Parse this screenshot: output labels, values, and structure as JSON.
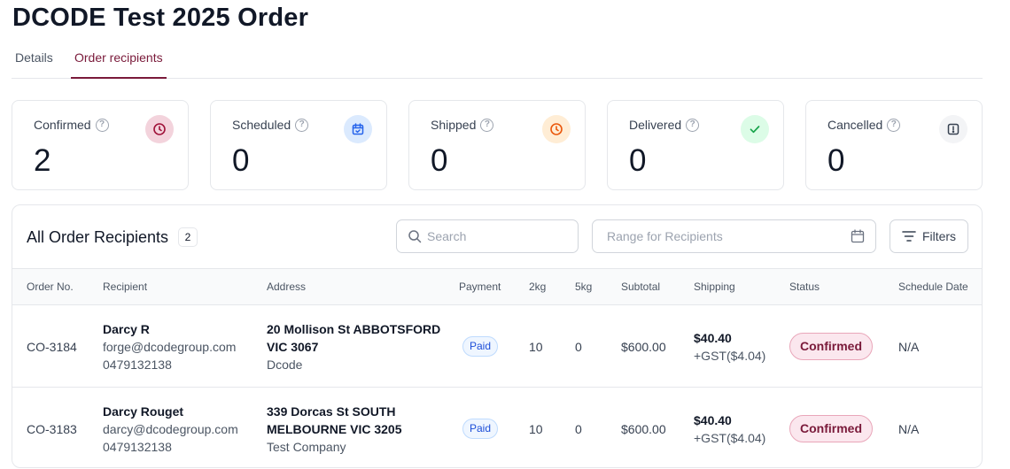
{
  "page": {
    "title": "DCODE Test 2025 Order"
  },
  "tabs": [
    {
      "label": "Details",
      "active": false
    },
    {
      "label": "Order recipients",
      "active": true
    }
  ],
  "stats": [
    {
      "label": "Confirmed",
      "value": "2",
      "icon": "clock-icon",
      "color": "#9f1239",
      "bg": "#f3d3dc"
    },
    {
      "label": "Scheduled",
      "value": "0",
      "icon": "calendar-icon",
      "color": "#2563eb",
      "bg": "#dbeafe"
    },
    {
      "label": "Shipped",
      "value": "0",
      "icon": "clock-icon",
      "color": "#ea580c",
      "bg": "#ffedd5"
    },
    {
      "label": "Delivered",
      "value": "0",
      "icon": "check-icon",
      "color": "#16a34a",
      "bg": "#dcfce7"
    },
    {
      "label": "Cancelled",
      "value": "0",
      "icon": "alert-icon",
      "color": "#374151",
      "bg": "#f3f4f6"
    }
  ],
  "recipients": {
    "title": "All Order Recipients",
    "count": "2",
    "search_placeholder": "Search",
    "range_placeholder": "Range for Recipients",
    "filters_label": "Filters",
    "columns": [
      "Order No.",
      "Recipient",
      "Address",
      "Payment",
      "2kg",
      "5kg",
      "Subtotal",
      "Shipping",
      "Status",
      "Schedule Date"
    ],
    "rows": [
      {
        "order_no": "CO-3184",
        "name": "Darcy R",
        "email": "forge@dcodegroup.com",
        "phone": "0479132138",
        "address_line1": "20 Mollison St ABBOTSFORD",
        "address_line2": "VIC 3067",
        "company": "Dcode",
        "payment": "Paid",
        "qty_2kg": "10",
        "qty_5kg": "0",
        "subtotal": "$600.00",
        "shipping": "$40.40",
        "gst": "+GST($4.04)",
        "status": "Confirmed",
        "schedule_date": "N/A"
      },
      {
        "order_no": "CO-3183",
        "name": "Darcy Rouget",
        "email": "darcy@dcodegroup.com",
        "phone": "0479132138",
        "address_line1": "339 Dorcas St SOUTH",
        "address_line2": "MELBOURNE VIC 3205",
        "company": "Test Company",
        "payment": "Paid",
        "qty_2kg": "10",
        "qty_5kg": "0",
        "subtotal": "$600.00",
        "shipping": "$40.40",
        "gst": "+GST($4.04)",
        "status": "Confirmed",
        "schedule_date": "N/A"
      }
    ]
  }
}
